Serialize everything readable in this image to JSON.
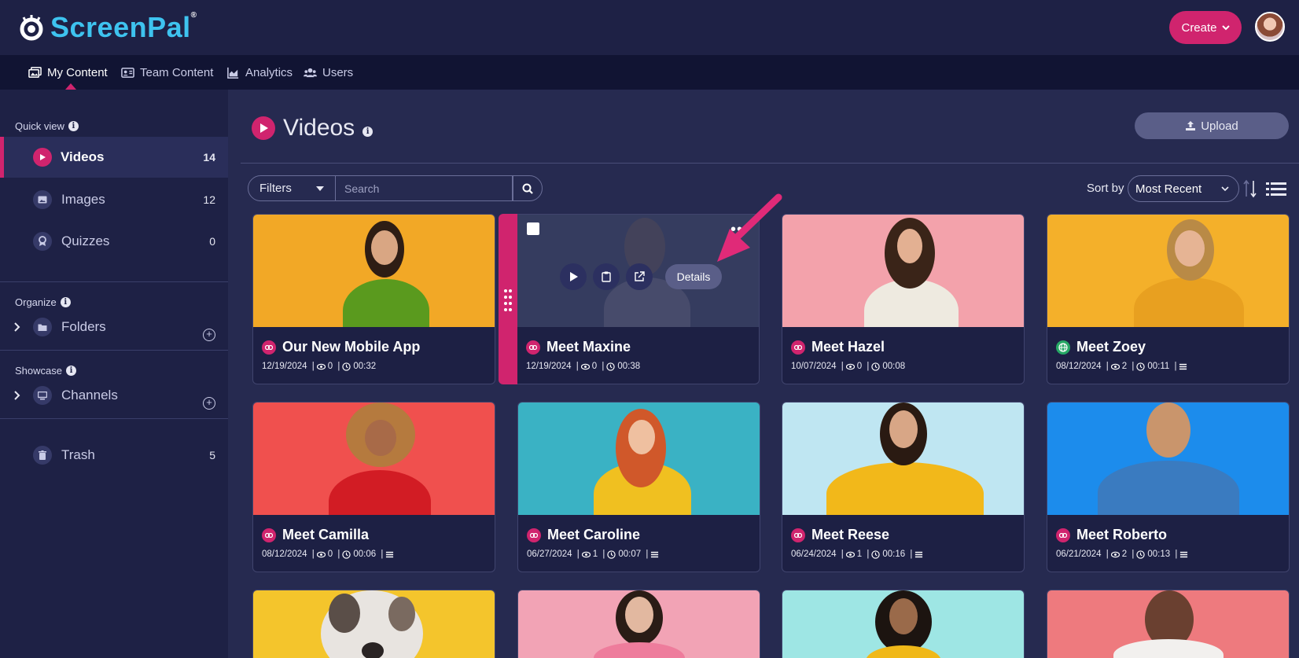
{
  "app": {
    "logo_text": "ScreenPal",
    "create_label": "Create"
  },
  "nav": {
    "items": [
      {
        "label": "My Content",
        "icon": "images-icon"
      },
      {
        "label": "Team Content",
        "icon": "id-card-icon"
      },
      {
        "label": "Analytics",
        "icon": "area-chart-icon"
      },
      {
        "label": "Users",
        "icon": "users-icon"
      }
    ]
  },
  "sidebar": {
    "quick_view_label": "Quick view",
    "items": [
      {
        "label": "Videos",
        "count": "14"
      },
      {
        "label": "Images",
        "count": "12"
      },
      {
        "label": "Quizzes",
        "count": "0"
      }
    ],
    "organize_label": "Organize",
    "folders_label": "Folders",
    "showcase_label": "Showcase",
    "channels_label": "Channels",
    "trash_label": "Trash",
    "trash_count": "5"
  },
  "main": {
    "title": "Videos",
    "upload_label": "Upload",
    "filters_label": "Filters",
    "search_placeholder": "Search",
    "sort_label": "Sort by",
    "sort_value": "Most Recent",
    "hover_details_label": "Details"
  },
  "colors": {
    "accent": "#d0246e",
    "brand": "#3ec3ef",
    "background": "#262a50"
  },
  "videos": [
    {
      "title": "Our New Mobile App",
      "date": "12/19/2024",
      "views": "0",
      "duration": "00:32",
      "link": "link"
    },
    {
      "title": "Meet Maxine",
      "date": "12/19/2024",
      "views": "0",
      "duration": "00:38",
      "link": "link"
    },
    {
      "title": "Meet Hazel",
      "date": "10/07/2024",
      "views": "0",
      "duration": "00:08",
      "link": "link"
    },
    {
      "title": "Meet Zoey",
      "date": "08/12/2024",
      "views": "2",
      "duration": "00:11",
      "link": "globe"
    },
    {
      "title": "Meet Camilla",
      "date": "08/12/2024",
      "views": "0",
      "duration": "00:06",
      "link": "link"
    },
    {
      "title": "Meet Caroline",
      "date": "06/27/2024",
      "views": "1",
      "duration": "00:07",
      "link": "link"
    },
    {
      "title": "Meet Reese",
      "date": "06/24/2024",
      "views": "1",
      "duration": "00:16",
      "link": "link"
    },
    {
      "title": "Meet Roberto",
      "date": "06/21/2024",
      "views": "2",
      "duration": "00:13",
      "link": "link"
    }
  ]
}
